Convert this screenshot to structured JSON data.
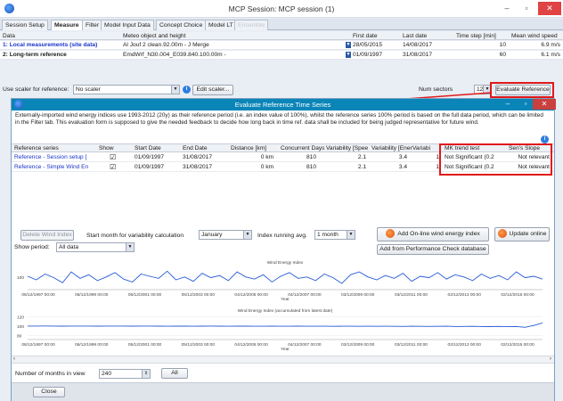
{
  "window": {
    "title": "MCP Session: MCP session (1)",
    "min": "–",
    "max": "▫",
    "close": "✕"
  },
  "tabs": [
    {
      "label": "Session Setup",
      "active": false,
      "disabled": false
    },
    {
      "label": "Measure",
      "active": true,
      "disabled": false
    },
    {
      "label": "Filter",
      "active": false,
      "disabled": false
    },
    {
      "label": "Model Input Data",
      "active": false,
      "disabled": false
    },
    {
      "label": "Concept Choice",
      "active": false,
      "disabled": false
    },
    {
      "label": "Model LT",
      "active": false,
      "disabled": false
    },
    {
      "label": "Ensemble",
      "active": false,
      "disabled": true
    }
  ],
  "data_table": {
    "headers": [
      "Data",
      "Meteo object and height",
      "First date",
      "Last date",
      "Time step [min]",
      "Mean wind speed"
    ],
    "rows": [
      {
        "data": "1: Local measurements (site data)",
        "meteo": "Al Jouf 2 clean.92.00m - J Merge",
        "first": "28/05/2015",
        "last": "14/08/2017",
        "step": "10",
        "mean": "6.9 m/s"
      },
      {
        "data": "2: Long-term reference",
        "meteo": "EmdWrf_N30.004_E039.840.100.00m -",
        "first": "01/09/1997",
        "last": "31/08/2017",
        "step": "60",
        "mean": "6.1 m/s"
      }
    ]
  },
  "scaler": {
    "label": "Use scaler for reference:",
    "value": "No scaler",
    "edit_button": "Edit scaler...",
    "num_sectors_label": "Num sectors",
    "num_sectors_value": "12",
    "evaluate_button": "Evaluate Reference"
  },
  "eval_window": {
    "title": "Evaluate Reference Time Series",
    "description": "Externally-imported wind energy indices use 1993-2012 (20y) as their reference period (i.e. an index value of 100%), whilst the reference series 100% period is based on the full data period, which can be limited in the Filter tab. This evaluation form is supposed to give the needed feedback to decide how long back in time ref. data shall be included for being judged representative for future wind.",
    "headers": [
      "Reference series",
      "Show",
      "Start Date",
      "End Date",
      "Distance [km]",
      "Concurrent Days",
      "Variability [Spee",
      "Variability [Ener",
      "Variabi",
      "MK trend test",
      "Sen's Slope"
    ],
    "rows": [
      {
        "name": "Reference - Session setup [",
        "show": "☑",
        "start": "01/09/1997",
        "end": "31/08/2017",
        "distance": "0 km",
        "days": "810",
        "var_speed": "2.1",
        "var_energy": "3.4",
        "var3": "1",
        "mk": "Not Significant (0.2",
        "sen": "Not relevant"
      },
      {
        "name": "Reference - Simple Wind En",
        "show": "☑",
        "start": "01/09/1997",
        "end": "31/08/2017",
        "distance": "0 km",
        "days": "810",
        "var_speed": "2.1",
        "var_energy": "3.4",
        "var3": "1",
        "mk": "Not Significant (0.2",
        "sen": "Not relevant"
      }
    ],
    "controls": {
      "delete_button": "Delete Wind Index",
      "start_month_label": "Start month for variability calculation",
      "start_month_value": "January",
      "running_avg_label": "Index running avg.",
      "running_avg_value": "1 month",
      "add_online_button": "Add On-line wind energy index",
      "update_online_button": "Update online",
      "add_perf_button": "Add from Performance Check database",
      "show_period_label": "Show period:",
      "show_period_value": "All data"
    },
    "months_label": "Number of months in view",
    "months_value": "240",
    "all_button": "All",
    "close_button": "Close"
  },
  "chart_data": [
    {
      "type": "line",
      "title": "Wind Energy Index",
      "xlabel": "Year",
      "ylabel": "",
      "y_ticks": [
        "100"
      ],
      "x_tick_labels": [
        "06/12/1997 00:00",
        "06/12/1999 00:00",
        "05/12/2001 00:00",
        "05/12/2003 00:00",
        "04/12/2005 00:00",
        "04/12/2007 00:00",
        "03/12/2009 00:00",
        "03/12/2011 00:00",
        "02/12/2013 00:00",
        "02/12/2015 00:00"
      ],
      "color": "#2a5bd7",
      "series": [
        {
          "values": [
            101,
            96,
            104,
            99,
            92,
            107,
            98,
            103,
            95,
            100,
            106,
            97,
            93,
            104,
            101,
            98,
            108,
            96,
            100,
            94,
            105,
            99,
            102,
            95,
            107,
            100,
            97,
            103,
            93,
            101,
            106,
            98,
            100,
            95,
            104,
            99,
            91,
            103,
            107,
            100,
            96,
            102,
            98,
            105,
            94,
            101,
            99,
            106,
            97,
            103,
            100,
            95,
            104,
            98,
            102,
            96,
            107,
            99,
            101,
            97
          ]
        }
      ]
    },
    {
      "type": "line",
      "title": "Wind Energy Index (accumulated from latest date)",
      "xlabel": "Year",
      "ylabel": "",
      "y_ticks": [
        "120",
        "100",
        "80"
      ],
      "x_tick_labels": [
        "06/12/1997 00:00",
        "06/12/1999 00:00",
        "05/12/2001 00:00",
        "05/12/2003 00:00",
        "04/12/2005 00:00",
        "04/12/2007 00:00",
        "03/12/2009 00:00",
        "03/12/2011 00:00",
        "02/12/2013 00:00",
        "02/12/2015 00:00"
      ],
      "color": "#2a5bd7",
      "series": [
        {
          "values": [
            100.2,
            100.1,
            100.3,
            100.2,
            100.0,
            100.1,
            100.2,
            100.1,
            100.0,
            100.1,
            100.2,
            100.1,
            100.0,
            100.1,
            100.2,
            100.0,
            99.9,
            100.0,
            100.1,
            99.9,
            100.0,
            100.1,
            100.0,
            99.9,
            100.0,
            100.1,
            99.8,
            99.9,
            100.0,
            99.9,
            99.8,
            100.0,
            99.9,
            99.8,
            99.9,
            99.7,
            99.8,
            99.9,
            99.6,
            99.8,
            99.7,
            99.9,
            99.6,
            99.5,
            99.8,
            99.7,
            99.4,
            99.6,
            99.8,
            99.3,
            99.5,
            99.7,
            99.2,
            99.0,
            99.4,
            98.8,
            99.2,
            97.5,
            101.5,
            107.0
          ]
        }
      ]
    }
  ]
}
